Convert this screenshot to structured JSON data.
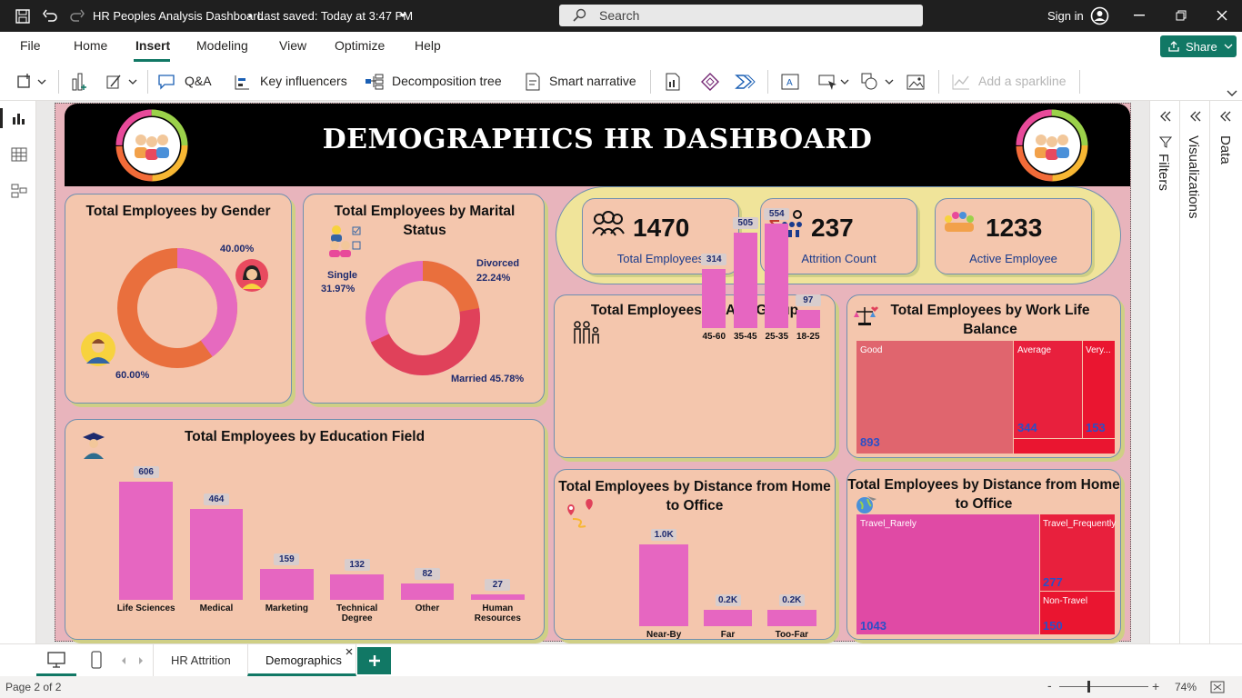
{
  "titlebar": {
    "title": "HR Peoples Analysis Dashboard",
    "saved": "Last saved: Today at 3:47 PM",
    "search_placeholder": "Search",
    "signin": "Sign in"
  },
  "menu": {
    "items": [
      "File",
      "Home",
      "Insert",
      "Modeling",
      "View",
      "Optimize",
      "Help"
    ],
    "active": "Insert",
    "share": "Share"
  },
  "ribbon": {
    "qa": "Q&A",
    "key_influencers": "Key influencers",
    "decomposition": "Decomposition tree",
    "smart_narrative": "Smart narrative",
    "sparkline": "Add a sparkline"
  },
  "dashboard": {
    "title": "DEMOGRAPHICS HR DASHBOARD",
    "kpis": [
      {
        "value": "1470",
        "label": "Total Employees"
      },
      {
        "value": "237",
        "label": "Attrition Count"
      },
      {
        "value": "1233",
        "label": "Active Employee"
      }
    ],
    "gender": {
      "title": "Total Employees by Gender",
      "female_pct": "40.00%",
      "male_pct": "60.00%"
    },
    "marital": {
      "title": "Total Employees by Marital Status",
      "divorced": "Divorced",
      "divorced_pct": "22.24%",
      "single": "Single",
      "single_pct": "31.97%",
      "married": "Married 45.78%"
    },
    "age": {
      "title": "Total Employees by Age Group"
    },
    "worklife": {
      "title": "Total Employees by Work Life Balance",
      "good": "Good",
      "good_val": "893",
      "average": "Average",
      "average_val": "344",
      "very": "Very...",
      "very_val": "153"
    },
    "education": {
      "title": "Total Employees by Education Field"
    },
    "distance": {
      "title": "Total Employees by Distance from Home to Office"
    },
    "travel": {
      "title": "Total Employees by Distance from Home to Office",
      "rarely": "Travel_Rarely",
      "rarely_val": "1043",
      "freq": "Travel_Frequently",
      "freq_val": "277",
      "non": "Non-Travel",
      "non_val": "150"
    }
  },
  "chart_data": [
    {
      "type": "pie",
      "title": "Total Employees by Gender",
      "categories": [
        "Female",
        "Male"
      ],
      "values": [
        40.0,
        60.0
      ],
      "unit": "%"
    },
    {
      "type": "pie",
      "title": "Total Employees by Marital Status",
      "categories": [
        "Divorced",
        "Married",
        "Single"
      ],
      "values": [
        22.24,
        45.78,
        31.97
      ],
      "unit": "%"
    },
    {
      "type": "bar",
      "title": "Total Employees by Age Group",
      "categories": [
        "45-60",
        "35-45",
        "25-35",
        "18-25"
      ],
      "values": [
        314,
        505,
        554,
        97
      ],
      "labels": [
        "314",
        "505",
        "554",
        "97"
      ]
    },
    {
      "type": "bar",
      "title": "Total Employees by Education Field",
      "categories": [
        "Life Sciences",
        "Medical",
        "Marketing",
        "Technical Degree",
        "Other",
        "Human Resources"
      ],
      "values": [
        606,
        464,
        159,
        132,
        82,
        27
      ],
      "labels": [
        "606",
        "464",
        "159",
        "132",
        "82",
        "27"
      ]
    },
    {
      "type": "bar",
      "title": "Total Employees by Distance from Home to Office",
      "categories": [
        "Near-By",
        "Far",
        "Too-Far"
      ],
      "values": [
        1000,
        200,
        200
      ],
      "labels": [
        "1.0K",
        "0.2K",
        "0.2K"
      ]
    }
  ],
  "right_panes": {
    "filters": "Filters",
    "visualizations": "Visualizations",
    "data": "Data"
  },
  "tabs": {
    "items": [
      "HR Attrition",
      "Demographics"
    ],
    "active": "Demographics"
  },
  "status": {
    "page": "Page 2 of 2",
    "zoom": "74%"
  },
  "colors": {
    "bar": "#e666c1",
    "accent": "#117865",
    "pink_bg": "#e8b4bc",
    "card": "#f4c6ad"
  }
}
